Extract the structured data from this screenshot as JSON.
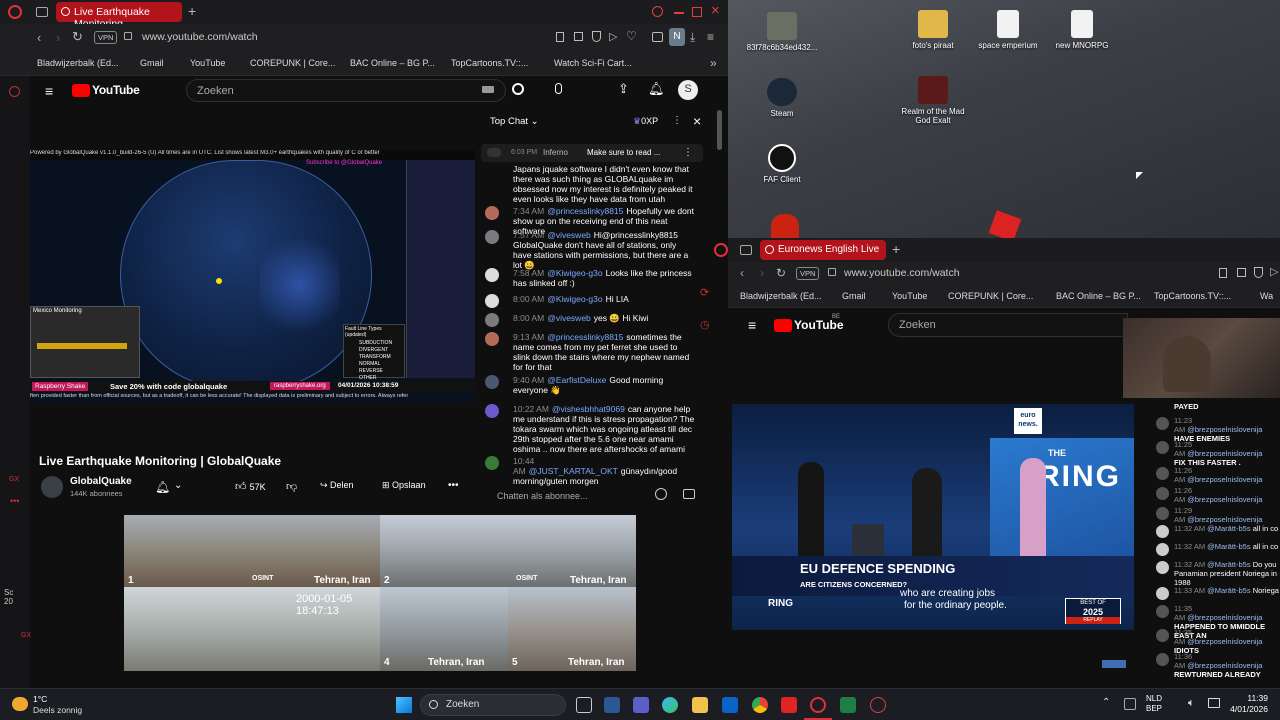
{
  "desktop": {
    "icons": [
      {
        "label": "83f78c6b34ed432..."
      },
      {
        "label": "foto's piraat"
      },
      {
        "label": "space emperium"
      },
      {
        "label": "new MNORPG"
      },
      {
        "label": "Steam"
      },
      {
        "label": "Realm of the Mad God Exalt"
      },
      {
        "label": "FAF Client"
      }
    ]
  },
  "browser1": {
    "tab_title": "Live Earthquake Monitoring",
    "vpn": "VPN",
    "url": "www.youtube.com/watch",
    "profile": "N",
    "bookmarks": [
      "Bladwijzerbalk (Ed...",
      "Gmail",
      "YouTube",
      "COREPUNK | Core...",
      "BAC Online – BG P...",
      "TopCartoons.TV::...",
      "Watch Sci-Fi Cart..."
    ]
  },
  "yt1": {
    "logo": "YouTube",
    "search_placeholder": "Zoeken",
    "avatar": "S",
    "video_header": "Powered by GlobalQuake v1.1.0_build-26-5 (U)     All times are in UTC. List shows latest M3.0+ earthquakes with quality of C or better",
    "subscribe_overlay": "Subscribe to @GlobalQuake",
    "mexico_label": "Mexico Monitoring",
    "fault_title": "Fault Line Types (updated)",
    "fault_types": [
      "SUBDUCTION",
      "DIVERGENT",
      "TRANSFORM",
      "NORMAL",
      "REVERSE",
      "OTHER"
    ],
    "promo": "Save 20% with code globalquake",
    "promo_brand": "Raspberry Shake",
    "promo_site": "raspberryshake.org",
    "timestamp": "04/01/2026 10:38:59",
    "disclaimer": "ften provided faster than from official sources, but as a tradeoff, it can be less accurate! The displayed data is preliminary and subject to errors. Always refer",
    "title": "Live Earthquake Monitoring | GlobalQuake",
    "channel": "GlobalQuake",
    "subs": "144K abonnees",
    "likes": "57K",
    "share": "Delen",
    "save": "Opslaan"
  },
  "chat1": {
    "header": "Top Chat",
    "points": "0XP",
    "pinned_time": "6:03 PM",
    "pinned_author": "Inferno",
    "pinned_text": "Make sure to read ...",
    "messages": [
      {
        "time": "",
        "author": "",
        "text": "Japans jquake software I didn't even know that there was such thing as GLOBALquake im obsessed now my interest is definitely peaked it even looks like they have data from utah"
      },
      {
        "time": "7:34 AM",
        "author": "@princesslinky8815",
        "text": "Hopefully we dont show up on the receiving end of this neat software"
      },
      {
        "time": "7:57 AM",
        "author": "@vivesweb",
        "text": "Hi@princesslinky8815 GlobalQuake don't have all of stations, only have stations with permissions, but there are a lot 😀"
      },
      {
        "time": "7:58 AM",
        "author": "@Kiwigeo-g3o",
        "text": "Looks like the princess has slinked off :)"
      },
      {
        "time": "8:00 AM",
        "author": "@Kiwigeo-g3o",
        "text": "Hi LIA"
      },
      {
        "time": "8:00 AM",
        "author": "@vivesweb",
        "text": "yes 😀 Hi Kiwi"
      },
      {
        "time": "9:13 AM",
        "author": "@princesslinky8815",
        "text": "sometimes the name comes from my pet ferret she used to slink down the stairs where my nephew named for for that"
      },
      {
        "time": "9:40 AM",
        "author": "@EarfistDeluxe",
        "text": "Good morning everyone 👋"
      },
      {
        "time": "10:22 AM",
        "author": "@vishesbhhat9069",
        "text": "can anyone help me understand if this is stress propagation? The tokara swarm which was ongoing atleast till dec 29th stopped after the 5.6 one near amami oshima .. now there are aftershocks of amami"
      },
      {
        "time": "10:44 AM",
        "author": "@JUST_KARTAL_OKT",
        "text": "günaydın/good morning/guten morgen"
      }
    ],
    "input_placeholder": "Chatten als abonnee..."
  },
  "cams": [
    {
      "num": "1",
      "city": "Tehran, Iran",
      "brand": "OSINT"
    },
    {
      "num": "2",
      "city": "Tehran, Iran",
      "brand": "OSINT"
    },
    {
      "num": "3",
      "city": "",
      "brand": "",
      "stamp": "2000-01-05  18:47:13"
    },
    {
      "num": "4",
      "city": "Tehran, Iran",
      "brand": ""
    },
    {
      "num": "5",
      "city": "Tehran, Iran",
      "brand": ""
    }
  ],
  "browser2": {
    "tab_title": "Euronews English Live",
    "vpn": "VPN",
    "url": "www.youtube.com/watch",
    "bookmarks": [
      "Bladwijzerbalk (Ed...",
      "Gmail",
      "YouTube",
      "COREPUNK | Core...",
      "BAC Online – BG P...",
      "TopCartoons.TV::...",
      "Wa"
    ],
    "logo": "YouTube",
    "region": "BE",
    "search_placeholder": "Zoeken",
    "news_logo_1": "euro",
    "news_logo_2": "news.",
    "ring_the": "THE",
    "ring_word": "RING",
    "lower_third_title": "EU DEFENCE SPENDING",
    "lower_third_sub": "ARE CITIZENS CONCERNED?",
    "subtitle_1": "who are creating jobs",
    "subtitle_2": "for the ordinary people.",
    "best_of": "BEST OF",
    "year": "2025",
    "replay": "REPLAY",
    "ring_bug": "RING"
  },
  "chat2": {
    "messages": [
      {
        "time": "",
        "author": "",
        "text": "PAYED"
      },
      {
        "time": "11:23 AM",
        "author": "@brezposelnislovenija",
        "text": "HAVE ENEMIES"
      },
      {
        "time": "11:25 AM",
        "author": "@brezposelnislovenija",
        "text": "FIX THIS FASTER ."
      },
      {
        "time": "11:26 AM",
        "author": "@brezposelnislovenija",
        "text": ""
      },
      {
        "time": "11:26 AM",
        "author": "@brezposelnislovenija",
        "text": ""
      },
      {
        "time": "11:29 AM",
        "author": "@brezposelnislovenija",
        "text": ""
      },
      {
        "time": "11:32 AM",
        "author": "@Marātt-b5s",
        "text": "all in co"
      },
      {
        "time": "11:32 AM",
        "author": "@Marātt-b5s",
        "text": "all in co"
      },
      {
        "time": "11:32 AM",
        "author": "@Marātt-b5s",
        "text": "Do you Panamian president Noriega in 1988"
      },
      {
        "time": "11:33 AM",
        "author": "@Marātt-b5s",
        "text": "Noriega"
      },
      {
        "time": "11:35 AM",
        "author": "@brezposelnislovenija",
        "text": "HAPPENED TO MMIDDLE EAST AN"
      },
      {
        "time": "11:35 AM",
        "author": "@brezposelnislovenija",
        "text": "IDIOTS"
      },
      {
        "time": "11:36 AM",
        "author": "@brezposelnislovenija",
        "text": "REWTURNED ALREADY"
      }
    ]
  },
  "side_text": {
    "sc": "Sc",
    "num": "20"
  },
  "taskbar": {
    "weather_temp": "1°C",
    "weather_desc": "Deels zonnig",
    "search": "Zoeken",
    "lang": "NLD",
    "kb": "BEP",
    "time": "11:39",
    "date": "4/01/2026"
  },
  "colors": {
    "accent": "#b3141c",
    "yt_red": "#ff0000",
    "link": "#7aa9ff"
  }
}
